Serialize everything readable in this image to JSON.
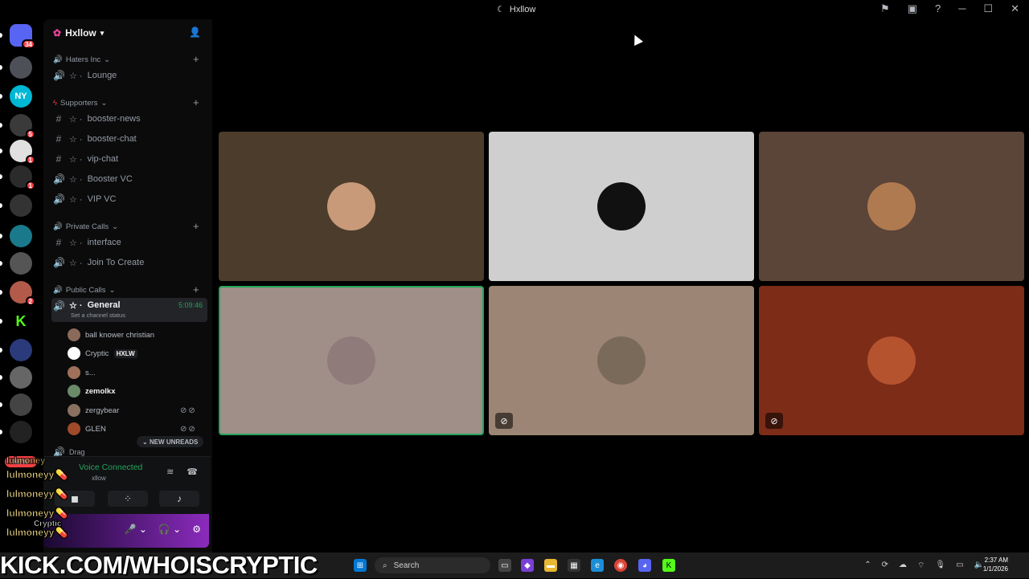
{
  "window": {
    "title": "Hxllow"
  },
  "server_rail": {
    "servers": [
      {
        "name": "home-icon",
        "badge": "34",
        "color": "#5865f2"
      },
      {
        "name": "server-1",
        "badge": "",
        "color": "#4e5058"
      },
      {
        "name": "server-ny",
        "badge": "",
        "color": "#00b8d4",
        "label": "NY"
      },
      {
        "name": "server-3",
        "badge": "5",
        "color": "#3a3a3a"
      },
      {
        "name": "server-4",
        "badge": "1",
        "color": "#e0e0e0"
      },
      {
        "name": "server-5",
        "badge": "1",
        "color": "#2b2b2b"
      },
      {
        "name": "server-6",
        "badge": "",
        "color": "#333333"
      },
      {
        "name": "server-7",
        "badge": "",
        "color": "#1a7a8c"
      },
      {
        "name": "server-8",
        "badge": "",
        "color": "#555555"
      },
      {
        "name": "server-9",
        "badge": "2",
        "color": "#b35a4a"
      },
      {
        "name": "server-kick",
        "badge": "",
        "color": "#000000",
        "label": "K"
      },
      {
        "name": "server-11",
        "badge": "",
        "color": "#2a3a7a"
      },
      {
        "name": "server-12",
        "badge": "",
        "color": "#666666"
      },
      {
        "name": "server-13",
        "badge": "",
        "color": "#444444"
      },
      {
        "name": "server-14",
        "badge": "",
        "color": "#222222"
      }
    ],
    "new_label": "NEW"
  },
  "sidebar": {
    "guild_name": "Hxllow",
    "categories": [
      {
        "label": "Haters Inc"
      },
      {
        "label": "Supporters"
      },
      {
        "label": "Private Calls"
      },
      {
        "label": "Public Calls"
      }
    ],
    "channels": [
      {
        "label": "Lounge",
        "type": "voice"
      },
      {
        "label": "booster-news",
        "type": "text"
      },
      {
        "label": "booster-chat",
        "type": "text"
      },
      {
        "label": "vip-chat",
        "type": "text"
      },
      {
        "label": "Booster VC",
        "type": "voice"
      },
      {
        "label": "VIP VC",
        "type": "voice"
      },
      {
        "label": "interface",
        "type": "text"
      },
      {
        "label": "Join To Create",
        "type": "voice"
      }
    ],
    "active_channel": {
      "label": "General",
      "time": "5:09:46",
      "status": "Set a channel status"
    },
    "voice_users": [
      {
        "name": "ball knower christian",
        "tag": "",
        "color": "#8a6a5a"
      },
      {
        "name": "Cryptic",
        "tag": "HXLW",
        "color": "#ffffff"
      },
      {
        "name": "s...",
        "tag": "",
        "color": "#a0705a"
      },
      {
        "name": "zemolkx",
        "tag": "",
        "color": "#6a8a6a"
      },
      {
        "name": "zergybear",
        "tag": "",
        "color": "#8a7060"
      },
      {
        "name": "GLEN",
        "tag": "",
        "color": "#a04a2a"
      }
    ],
    "new_unreads": "NEW UNREADS",
    "partial_channel": "Drag",
    "voice_panel": {
      "title": "Voice Connected",
      "subtitle": "xllow"
    },
    "overlay_names": [
      "lulmoneyy",
      "lulmoneyy",
      "lulmoneyy",
      "lulmoneyy"
    ],
    "overlay_partial": "lulmoney",
    "overlay_cryptic": "Cryptic"
  },
  "stage": {
    "tiles": [
      {
        "bg": "#4c3c2c",
        "avatar": "#c89a7a",
        "speaking": false,
        "deafened": false
      },
      {
        "bg": "#cfcfcf",
        "avatar": "#111111",
        "speaking": false,
        "deafened": false
      },
      {
        "bg": "#5b4438",
        "avatar": "#b07a50",
        "speaking": false,
        "deafened": false
      },
      {
        "bg": "#a08e89",
        "avatar": "#8f7c7a",
        "speaking": true,
        "deafened": false
      },
      {
        "bg": "#9c8574",
        "avatar": "#7a6a5a",
        "speaking": false,
        "deafened": true
      },
      {
        "bg": "#7d2c17",
        "avatar": "#b5532f",
        "speaking": false,
        "deafened": true
      }
    ]
  },
  "overlay_banner": "KICK.COM/WHOISCRYPTIC",
  "taskbar": {
    "search_placeholder": "Search",
    "time": "2:37 AM",
    "date": "1/1/2026"
  }
}
